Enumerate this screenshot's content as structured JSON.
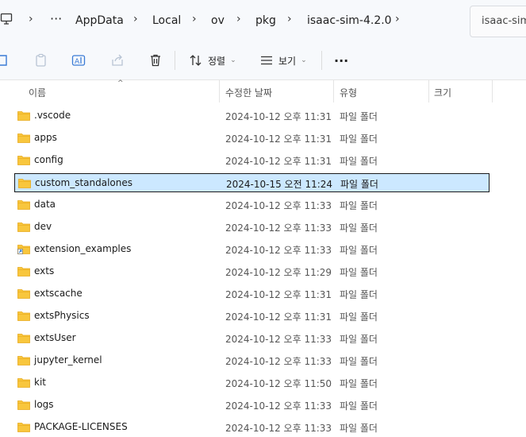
{
  "breadcrumb": {
    "items": [
      "AppData",
      "Local",
      "ov",
      "pkg",
      "isaac-sim-4.2.0"
    ],
    "overflow": "···"
  },
  "search": {
    "placeholder": "isaac-sim"
  },
  "toolbar": {
    "sort_label": "정렬",
    "view_label": "보기",
    "more": "···"
  },
  "columns": {
    "name": "이름",
    "modified": "수정한 날짜",
    "type": "유형",
    "size": "크기"
  },
  "files": [
    {
      "name": ".vscode",
      "date": "2024-10-12 오후 11:31",
      "type": "파일 폴더"
    },
    {
      "name": "apps",
      "date": "2024-10-12 오후 11:31",
      "type": "파일 폴더"
    },
    {
      "name": "config",
      "date": "2024-10-12 오후 11:31",
      "type": "파일 폴더"
    },
    {
      "name": "custom_standalones",
      "date": "2024-10-15 오전 11:24",
      "type": "파일 폴더",
      "selected": true
    },
    {
      "name": "data",
      "date": "2024-10-12 오후 11:33",
      "type": "파일 폴더"
    },
    {
      "name": "dev",
      "date": "2024-10-12 오후 11:33",
      "type": "파일 폴더"
    },
    {
      "name": "extension_examples",
      "date": "2024-10-12 오후 11:33",
      "type": "파일 폴더",
      "shortcut": true
    },
    {
      "name": "exts",
      "date": "2024-10-12 오후 11:29",
      "type": "파일 폴더"
    },
    {
      "name": "extscache",
      "date": "2024-10-12 오후 11:31",
      "type": "파일 폴더"
    },
    {
      "name": "extsPhysics",
      "date": "2024-10-12 오후 11:31",
      "type": "파일 폴더"
    },
    {
      "name": "extsUser",
      "date": "2024-10-12 오후 11:33",
      "type": "파일 폴더"
    },
    {
      "name": "jupyter_kernel",
      "date": "2024-10-12 오후 11:33",
      "type": "파일 폴더"
    },
    {
      "name": "kit",
      "date": "2024-10-12 오후 11:50",
      "type": "파일 폴더"
    },
    {
      "name": "logs",
      "date": "2024-10-12 오후 11:33",
      "type": "파일 폴더"
    },
    {
      "name": "PACKAGE-LICENSES",
      "date": "2024-10-12 오후 11:33",
      "type": "파일 폴더"
    }
  ],
  "colors": {
    "folder": "#f8c63d",
    "folder_dark": "#e8a91b",
    "selection": "#cce8ff",
    "chrome": "#f7f9fc"
  }
}
